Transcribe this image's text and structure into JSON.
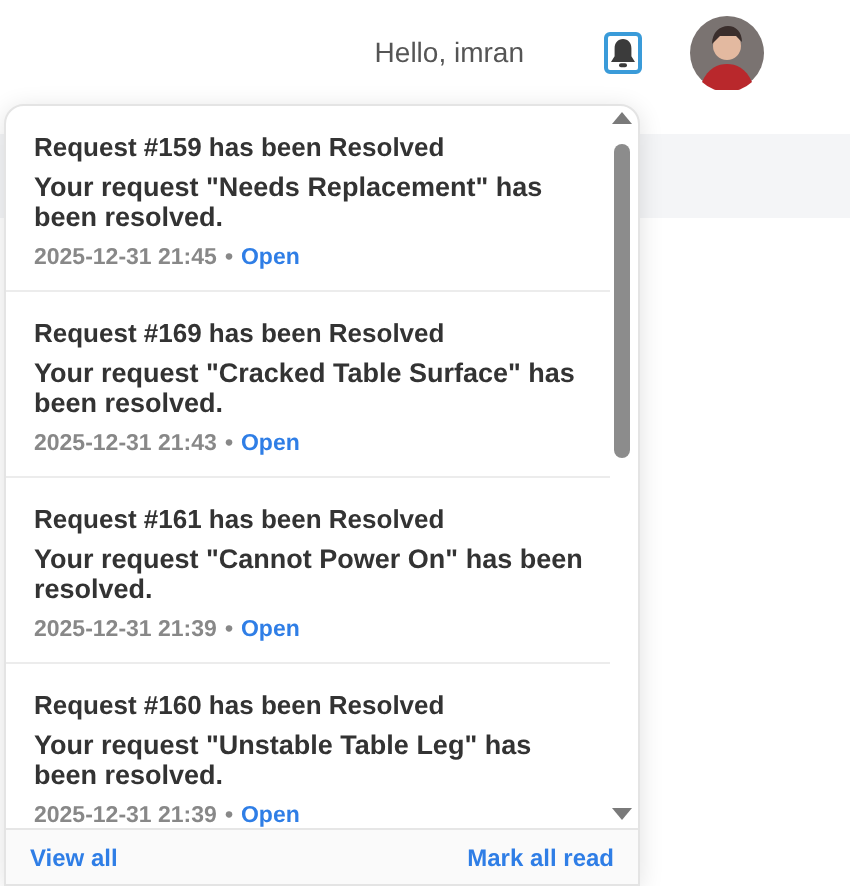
{
  "header": {
    "greeting": "Hello, imran"
  },
  "notifications": [
    {
      "title": "Request #159 has been Resolved",
      "message": "Your request \"Needs Replacement\" has been resolved.",
      "time": "2025-12-31 21:45",
      "separator": "•",
      "link": "Open"
    },
    {
      "title": "Request #169 has been Resolved",
      "message": "Your request \"Cracked Table Surface\" has been resolved.",
      "time": "2025-12-31 21:43",
      "separator": "•",
      "link": "Open"
    },
    {
      "title": "Request #161 has been Resolved",
      "message": "Your request \"Cannot Power On\" has been resolved.",
      "time": "2025-12-31 21:39",
      "separator": "•",
      "link": "Open"
    },
    {
      "title": "Request #160 has been Resolved",
      "message": "Your request \"Unstable Table Leg\" has been resolved.",
      "time": "2025-12-31 21:39",
      "separator": "•",
      "link": "Open"
    }
  ],
  "footer": {
    "view_all": "View all",
    "mark_all_read": "Mark all read"
  }
}
